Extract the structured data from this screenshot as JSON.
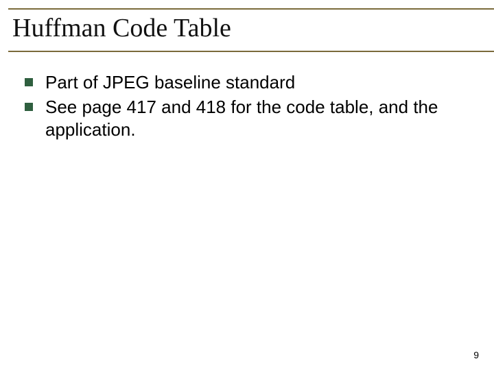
{
  "title": "Huffman Code Table",
  "bullets": [
    "Part of JPEG baseline standard",
    "See page 417 and 418 for the code table, and the application."
  ],
  "page_number": "9"
}
